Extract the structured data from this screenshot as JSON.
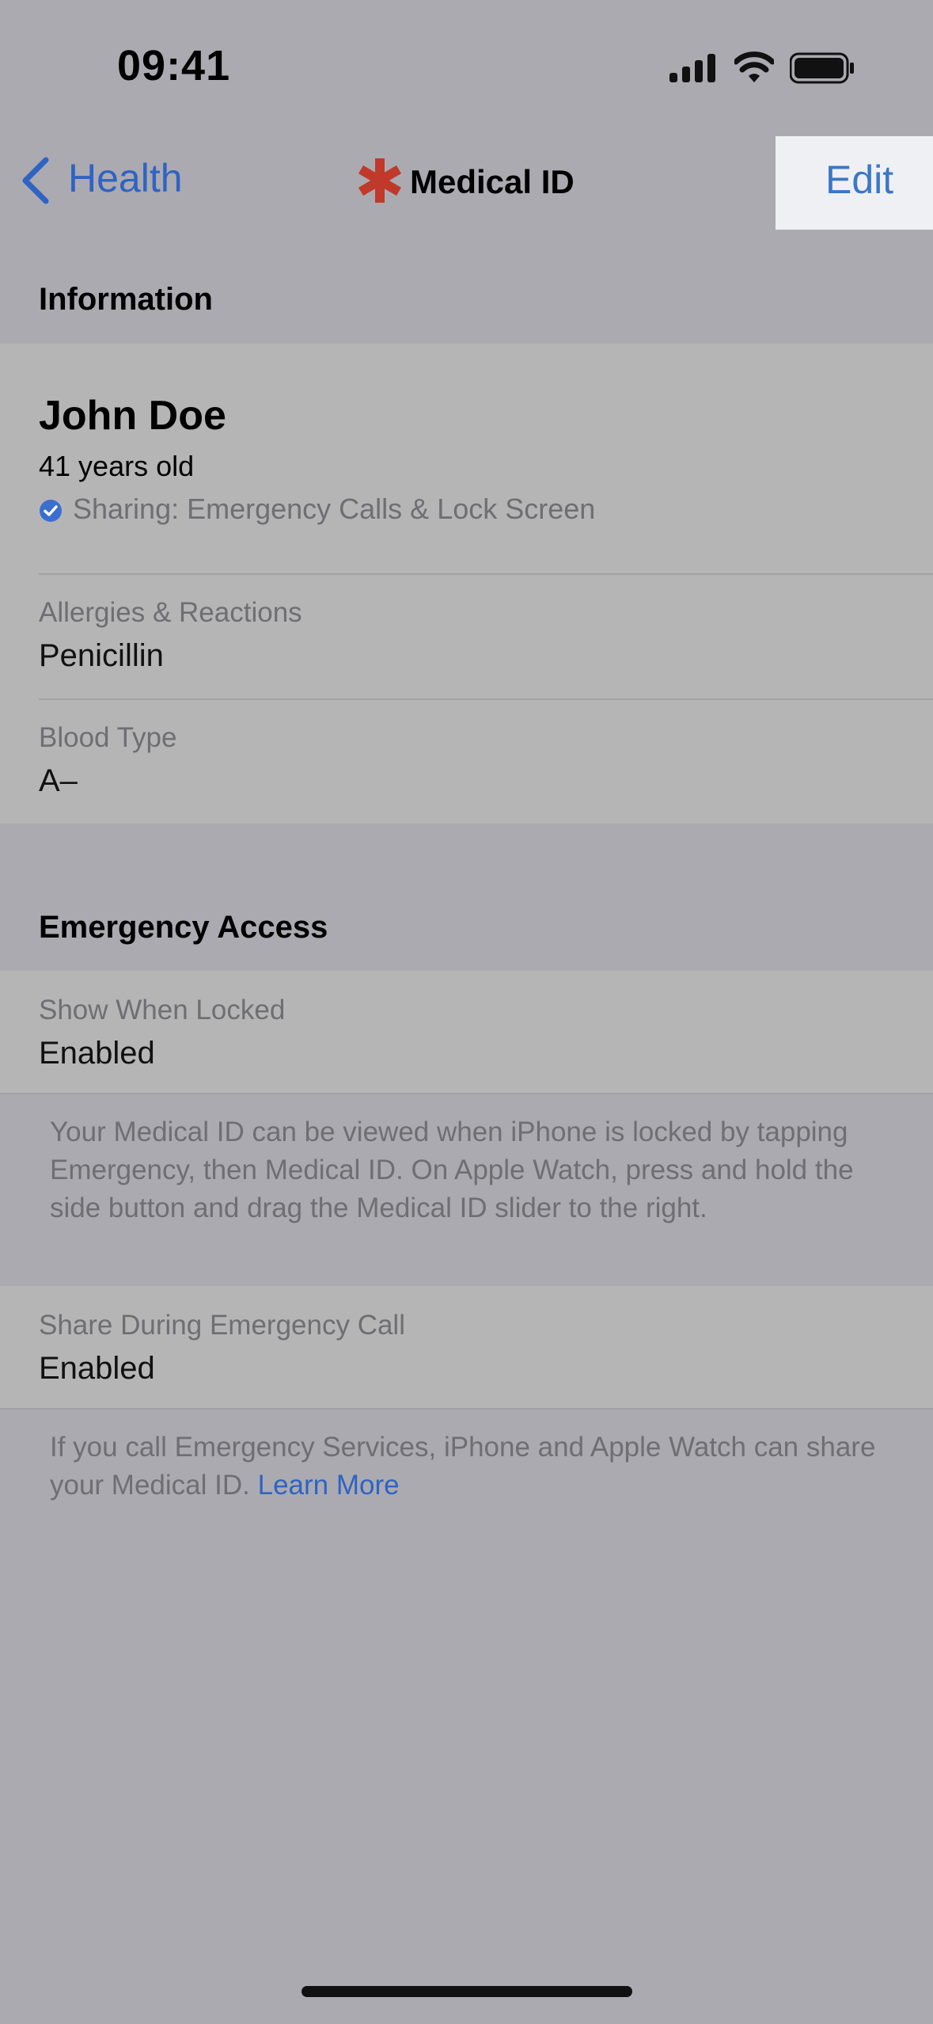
{
  "status_bar": {
    "time": "09:41"
  },
  "nav": {
    "back_label": "Health",
    "title": "Medical ID",
    "edit_label": "Edit"
  },
  "information": {
    "header": "Information",
    "name": "John Doe",
    "age": "41 years old",
    "sharing": "Sharing: Emergency Calls & Lock Screen",
    "allergies_label": "Allergies & Reactions",
    "allergies_value": "Penicillin",
    "blood_label": "Blood Type",
    "blood_value": "A–"
  },
  "emergency_access": {
    "header": "Emergency Access",
    "locked_label": "Show When Locked",
    "locked_value": "Enabled",
    "locked_note": "Your Medical ID can be viewed when iPhone is locked by tapping Emergency, then Medical ID. On Apple Watch, press and hold the side button and drag the Medical ID slider to the right.",
    "call_label": "Share During Emergency Call",
    "call_value": "Enabled",
    "call_note": "If you call Emergency Services, iPhone and Apple Watch can share your Medical ID.",
    "learn_more": "Learn More"
  },
  "colors": {
    "accent": "#2f63c4",
    "medical_star": "#c0392b",
    "check": "#3a6fd0"
  },
  "icons": [
    "signal-icon",
    "wifi-icon",
    "battery-icon",
    "chevron-left-icon",
    "medical-star-icon",
    "checkmark-circle-icon"
  ]
}
